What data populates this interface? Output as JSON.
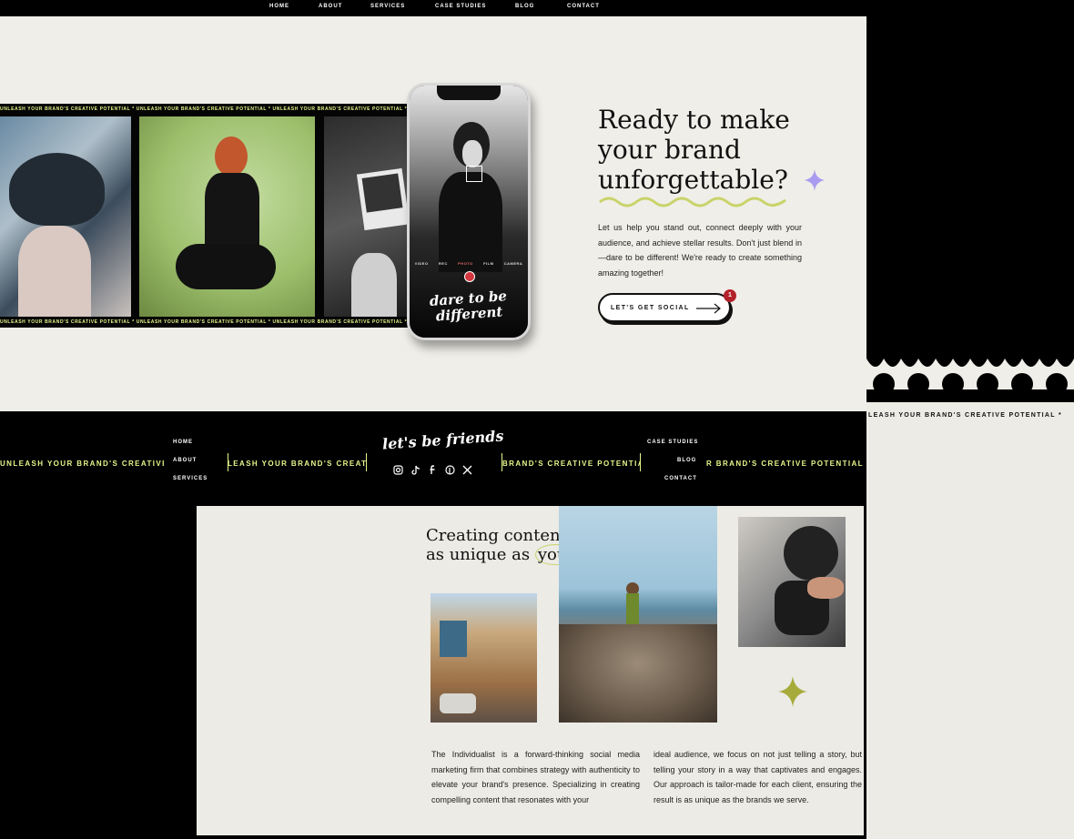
{
  "nav": {
    "items": [
      "HOME",
      "ABOUT",
      "SERVICES",
      "CASE STUDIES",
      "BLOG",
      "CONTACT"
    ]
  },
  "hero": {
    "filmstrip_text": "UNLEASH YOUR BRAND'S CREATIVE POTENTIAL * UNLEASH YOUR BRAND'S CREATIVE POTENTIAL * UNLEASH YOUR BRAND'S CREATIVE POTENTIAL * UNLEASH YOUR",
    "phone": {
      "modes": [
        "VIDEO",
        "REC",
        "PHOTO",
        "FILM",
        "CAMERA"
      ],
      "script_line1": "dare to be",
      "script_line2": "different"
    },
    "heading_line1": "Ready to make",
    "heading_line2": "your brand",
    "heading_line3": "unforgettable?",
    "body": "Let us help you stand out, connect deeply with your audience, and achieve stellar results. Don't just blend in—dare to be different! We're ready to create something amazing together!",
    "cta_label": "LET'S GET SOCIAL",
    "cta_badge": "1"
  },
  "footer": {
    "left_links": [
      "HOME",
      "ABOUT",
      "SERVICES"
    ],
    "right_links": [
      "CASE STUDIES",
      "BLOG",
      "CONTACT"
    ],
    "script": "let's be friends",
    "ticker_1": "UNLEASH YOUR BRAND'S CREATIVE P",
    "ticker_2": "LEASH YOUR BRAND'S CREATIVE",
    "ticker_3": "BRAND'S CREATIVE POTENTIAL",
    "ticker_4": "R BRAND'S CREATIVE POTENTIAL *",
    "social_icons": [
      "instagram-icon",
      "tiktok-icon",
      "facebook-icon",
      "pinterest-icon",
      "x-icon"
    ]
  },
  "side": {
    "ticker": "LEASH YOUR BRAND'S CREATIVE POTENTIAL *"
  },
  "section": {
    "heading_line1": "Creating content",
    "heading_line2_prefix": "as unique as ",
    "heading_line2_highlight": "you.",
    "col1": "The Individualist is a forward-thinking social media marketing firm that combines strategy with authenticity to elevate your brand's presence. Specializing in creating compelling content that resonates with your",
    "col2": "ideal audience, we focus on not just telling a story, but telling your story in a way that captivates and engages. Our approach is tailor-made for each client, ensuring the result is as unique as the brands we serve."
  },
  "colors": {
    "accent_lime": "#e8f58a",
    "sparkle_purple": "#a89bf0",
    "sparkle_olive": "#a6ab3c",
    "badge_red": "#b3222b",
    "cream": "#f0eee8"
  }
}
